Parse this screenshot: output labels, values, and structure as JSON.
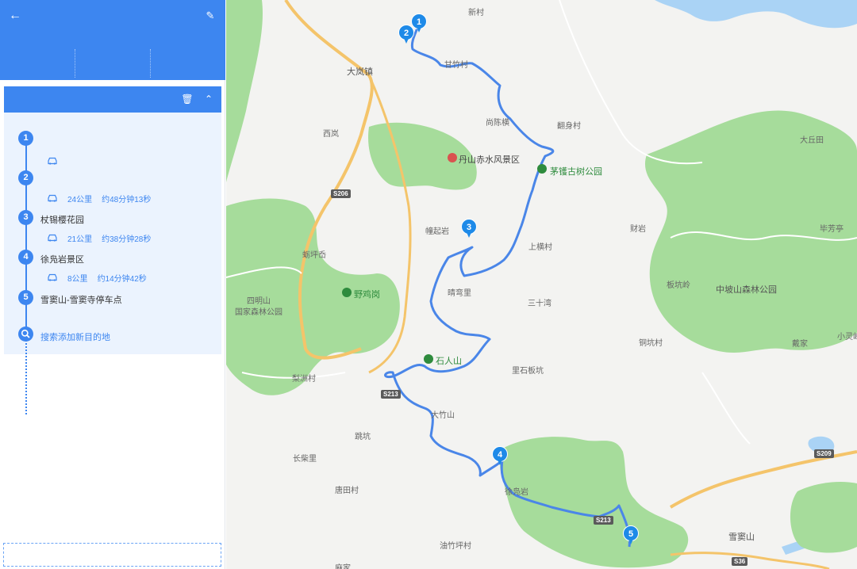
{
  "header": {
    "back_icon": "arrow-left-icon",
    "edit_icon": "pencil-icon",
    "tabs": [
      "",
      "",
      ""
    ]
  },
  "route": {
    "title": "",
    "delete_icon": "trash-icon",
    "collapse_icon": "chevron-up-icon",
    "stops": [
      {
        "num": "1",
        "name": ""
      },
      {
        "num": "2",
        "name": ""
      },
      {
        "num": "3",
        "name": "杖锡樱花园"
      },
      {
        "num": "4",
        "name": "徐凫岩景区"
      },
      {
        "num": "5",
        "name": "雪窦山-雪窦寺停车点"
      }
    ],
    "segments": [
      {
        "distance": "",
        "duration": ""
      },
      {
        "distance": "24公里",
        "duration": "约48分钟13秒"
      },
      {
        "distance": "21公里",
        "duration": "约38分钟28秒"
      },
      {
        "distance": "8公里",
        "duration": "约14分钟42秒"
      }
    ],
    "add_destination": "搜索添加新目的地",
    "search_icon": "search-icon",
    "car_icon": "car-icon"
  },
  "map": {
    "colors": {
      "route": "#4a86e8",
      "forest": "#a6dc9b",
      "water": "#aad3f5",
      "road": "#f4c46a",
      "marker": "#1e8ae8"
    },
    "places": {
      "xincun": "新村",
      "ganzhucun": "甘竹村",
      "dalanzhen": "大岚镇",
      "shangchenheng": "尚陈横",
      "fanshencun": "翻身村",
      "xilan": "西岚",
      "danshan": "丹山赤水风景区",
      "zhexi_park": "茅镬古树公园",
      "daqiutian": "大丘田",
      "bolingshu": "毕芳亭",
      "caiyan": "财岩",
      "huaqiyan": "幢起岩",
      "shanghengcun": "上横村",
      "hupingxian": "蛎坪岙",
      "yejigang": "野鸡岗",
      "anwanli": "晴弯里",
      "sanshiwan": "三十湾",
      "banbianling": "板坑岭",
      "zhongposhan": "中坡山森林公园",
      "siming": "四明山\n国家森林公园",
      "dongkeng": "铜坑村",
      "daijia": "戴家",
      "xiaolingfeng": "小灵峰",
      "shirenshan": "石人山",
      "lishibankeng": "里石板坑",
      "lizhoucun": "梨洲村",
      "dazhushan": "大竹山",
      "tiaokeng": "跳坑",
      "changchaili": "长柴里",
      "xiangtiancun": "唐田村",
      "xuedouding": "徐凫岩",
      "youzhupingcun": "油竹坪村",
      "mamishan": "雪窦山",
      "majia": "麻家"
    },
    "roads": [
      "S206",
      "S213",
      "S213",
      "S209",
      "S36"
    ],
    "markers": [
      "1",
      "2",
      "3",
      "4",
      "5"
    ]
  }
}
